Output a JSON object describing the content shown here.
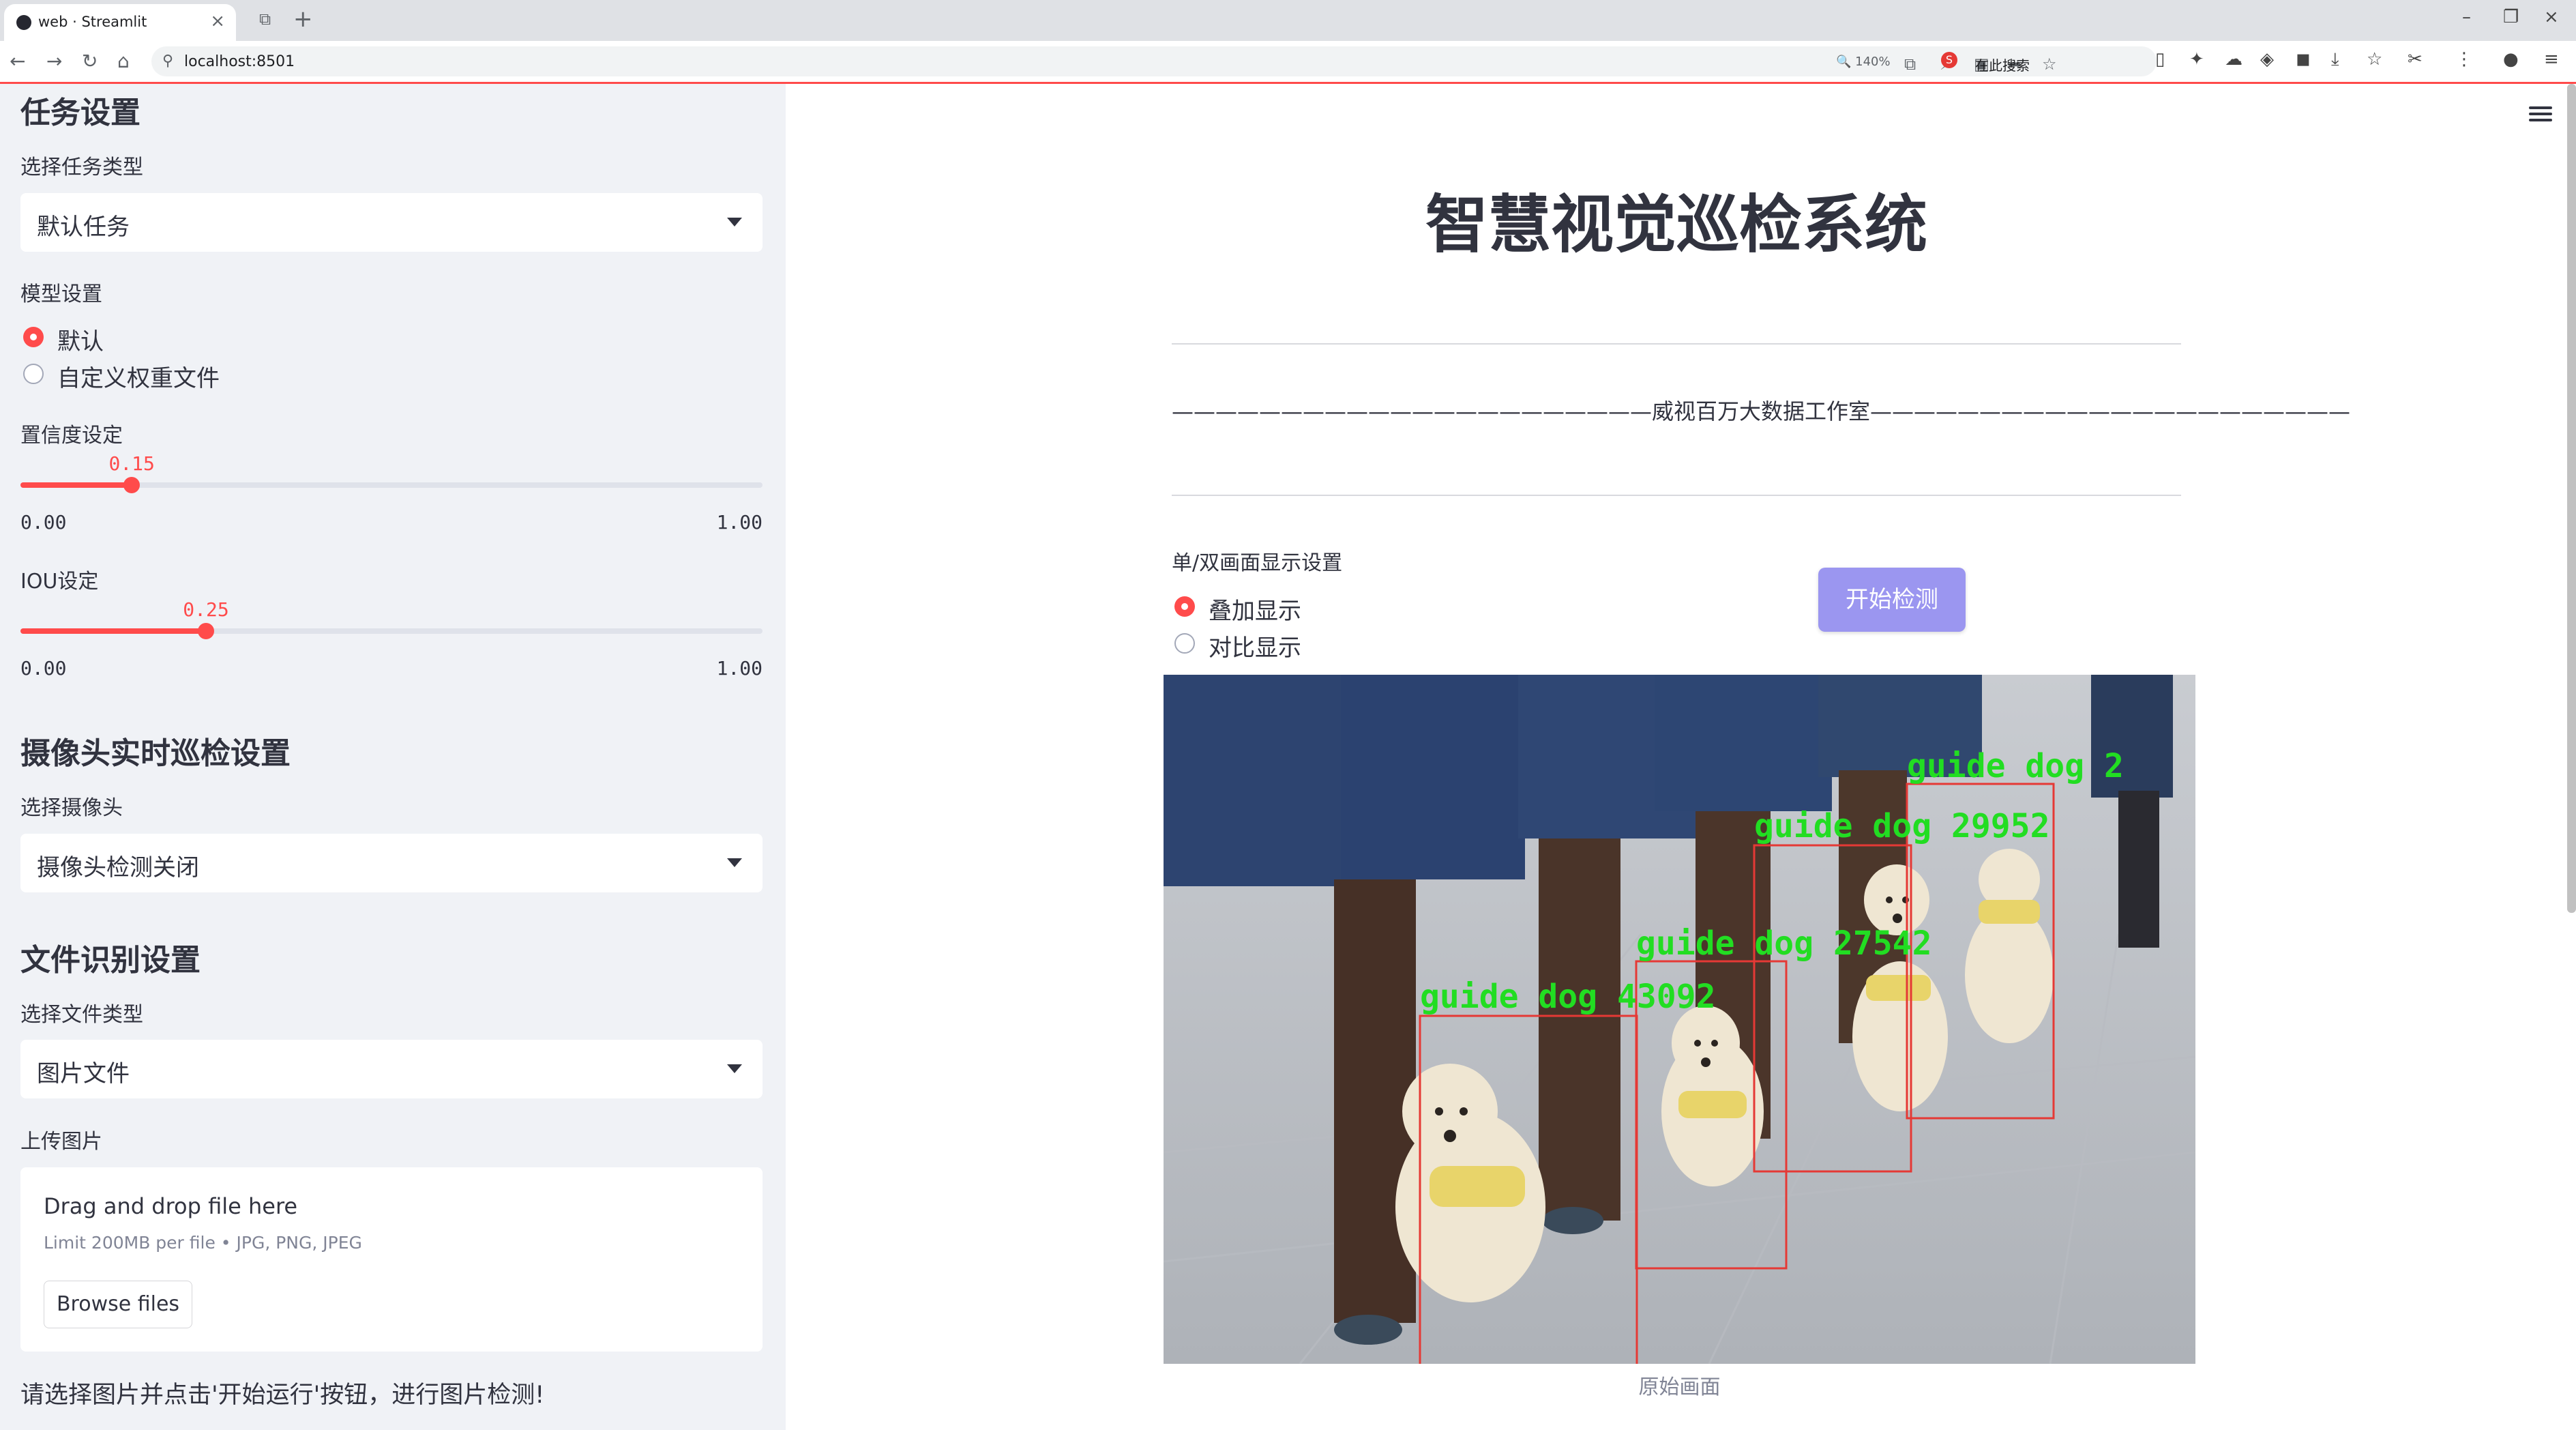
{
  "browser": {
    "tab_title": "web · Streamlit",
    "url": "localhost:8501",
    "zoom": "140%",
    "search_label": "在此搜索"
  },
  "sidebar": {
    "task_header": "任务设置",
    "task_type_label": "选择任务类型",
    "task_type_value": "默认任务",
    "model_label": "模型设置",
    "model_options": [
      "默认",
      "自定义权重文件"
    ],
    "model_selected": "默认",
    "conf_label": "置信度设定",
    "conf_value": "0.15",
    "conf_fraction": 0.15,
    "conf_min": "0.00",
    "conf_max": "1.00",
    "iou_label": "IOU设定",
    "iou_value": "0.25",
    "iou_fraction": 0.25,
    "iou_min": "0.00",
    "iou_max": "1.00",
    "camera_header": "摄像头实时巡检设置",
    "camera_label": "选择摄像头",
    "camera_value": "摄像头检测关闭",
    "file_header": "文件识别设置",
    "file_type_label": "选择文件类型",
    "file_type_value": "图片文件",
    "upload_label": "上传图片",
    "upload_title": "Drag and drop file here",
    "upload_limit": "Limit 200MB per file • JPG, PNG, JPEG",
    "browse_label": "Browse files",
    "note": "请选择图片并点击'开始运行'按钮，进行图片检测!"
  },
  "main": {
    "title": "智慧视觉巡检系统",
    "subtitle": "——————————————————————威视百万大数据工作室——————————————————————",
    "display_mode_label": "单/双画面显示设置",
    "display_options": [
      "叠加显示",
      "对比显示"
    ],
    "display_selected": "叠加显示",
    "start_button": "开始检测",
    "image_caption": "原始画面",
    "detections": [
      {
        "label": "guide dog 43092"
      },
      {
        "label": "guide dog 27542"
      },
      {
        "label": "guide dog 29952"
      },
      {
        "label": "guide dog 2"
      }
    ]
  },
  "colors": {
    "accent": "#ff4b4b",
    "sidebar_bg": "#f0f2f6",
    "button_bg": "#9b96f0",
    "detection_box": "#e53935",
    "detection_text": "#22dd22"
  }
}
